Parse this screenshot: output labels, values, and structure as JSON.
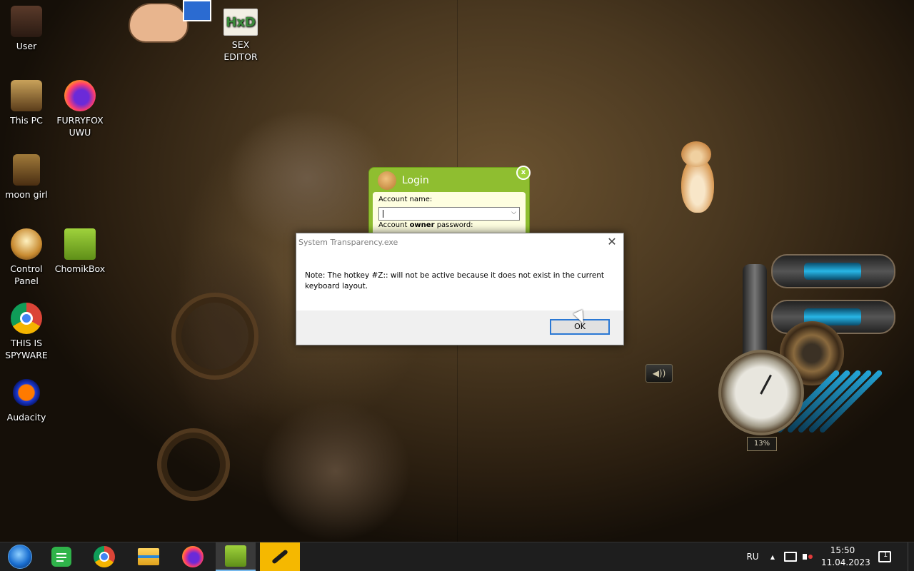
{
  "desktop_icons": [
    {
      "label": "User",
      "icon": "user-folder-icon"
    },
    {
      "label": "SEX\nEDITOR",
      "icon": "hxd-editor-icon"
    },
    {
      "label": "This PC",
      "icon": "computer-icon"
    },
    {
      "label": "FURRYFOX\nUWU",
      "icon": "firefox-icon"
    },
    {
      "label": "moon girl",
      "icon": "folder-icon"
    },
    {
      "label": "Control\nPanel",
      "icon": "control-panel-icon"
    },
    {
      "label": "ChomikBox",
      "icon": "chomikbox-icon"
    },
    {
      "label": "THIS IS\nSPYWARE",
      "icon": "chrome-icon"
    },
    {
      "label": "Audacity",
      "icon": "audacity-icon"
    }
  ],
  "login_window": {
    "title": "Login",
    "close": "x",
    "account_name_label": "Account name:",
    "password_label_pre": "Account ",
    "password_label_bold": "owner",
    "password_label_post": " password:",
    "combo_arrow": "⌵"
  },
  "dialog": {
    "title": "System Transparency.exe",
    "close": "✕",
    "message": "Note: The hotkey #Z:: will not be active because it does not exist in the current keyboard layout.",
    "ok_label": "OK"
  },
  "gauge": {
    "percent_text": "13%"
  },
  "taskbar": {
    "apps": [
      "start-orb-icon",
      "spotify-like-icon",
      "chrome-icon",
      "file-explorer-icon",
      "firefox-icon",
      "chomikbox-icon",
      "wrench-tool-icon"
    ],
    "language": "RU",
    "tray_up": "▲",
    "time": "15:50",
    "date": "11.04.2023",
    "notification_count": "1"
  },
  "colors": {
    "login_green": "#8fbe30",
    "ok_focus_border": "#2a78d4",
    "taskbar_bg": "#1e1e1e",
    "highlight_app": "#f5b800"
  }
}
